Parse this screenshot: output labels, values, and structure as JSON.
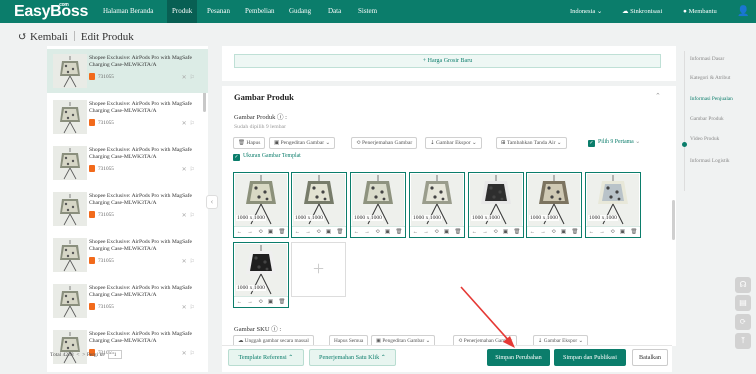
{
  "topbar": {
    "logo": "EasyBoss",
    "logo_sup": ".com",
    "nav": [
      "Halaman Beranda",
      "Produk",
      "Pesanan",
      "Pembelian",
      "Gudang",
      "Data",
      "Sistem"
    ],
    "active_nav": "Produk",
    "language": "Indonesia",
    "sync": "Sinkronisasi",
    "help": "Membantu",
    "colors": {
      "primary": "#0b7d6b",
      "accent_orange": "#f26a1b",
      "arrow_red": "#e53935"
    }
  },
  "breadcrumb": {
    "back": "Kembali",
    "title": "Edit Produk"
  },
  "product_list": {
    "items": [
      {
        "title": "Shopee Exclusive: AirPods Pro with MagSafe Charging Case-MLWK3TA/A",
        "id": "731055",
        "selected": true
      },
      {
        "title": "Shopee Exclusive: AirPods Pro with MagSafe Charging Case-MLWK3TA/A",
        "id": "731055",
        "selected": false
      },
      {
        "title": "Shopee Exclusive: AirPods Pro with MagSafe Charging Case-MLWK3TA/A",
        "id": "731055",
        "selected": false
      },
      {
        "title": "Shopee Exclusive: AirPods Pro with MagSafe Charging Case-MLWK3TA/A",
        "id": "731055",
        "selected": false
      },
      {
        "title": "Shopee Exclusive: AirPods Pro with MagSafe Charging Case-MLWK3TA/A",
        "id": "731055",
        "selected": false
      },
      {
        "title": "Shopee Exclusive: AirPods Pro with MagSafe Charging Case-MLWK3TA/A",
        "id": "731055",
        "selected": false
      },
      {
        "title": "Shopee Exclusive: AirPods Pro with MagSafe Charging Case-MLWK3TA/A",
        "id": "731055",
        "selected": false
      }
    ],
    "pager": {
      "total": "Total 4238",
      "prev": "<",
      "next": ">",
      "goto": "Pergi ke",
      "page": "1"
    }
  },
  "group_price_button": "+ Harga Grosir Baru",
  "product_images": {
    "heading": "Gambar Produk",
    "label": "Gambar Produk",
    "selected_hint": "Sudah dipilih 9 lembar",
    "toolbar": [
      "Hapus",
      "Pengeditan Gambar",
      "Penerjemahan Gambar",
      "Gambar Ekspor",
      "Tambahkan Tanda Air"
    ],
    "pick9": "Pilih 9 Pertama",
    "size_template": "Ukuran Gambar Templat",
    "images": [
      {
        "size": "1000 x 1000"
      },
      {
        "size": "1000 x 1000"
      },
      {
        "size": "1000 x 1000"
      },
      {
        "size": "1000 x 1000"
      },
      {
        "size": "1000 x 1000"
      },
      {
        "size": "1000 x 1000"
      },
      {
        "size": "1000 x 1000"
      },
      {
        "size": "1000 x 1000"
      }
    ],
    "tool_glyphs": [
      "←",
      "→",
      "⟲",
      "▣",
      "🗑"
    ]
  },
  "sku_images": {
    "label": "Gambar SKU",
    "toolbar": [
      "Unggah gambar secara massal",
      "Hapus Semua",
      "Pengeditan Gambar",
      "Penerjemahan Gambar",
      "Gambar Ekspor"
    ]
  },
  "bottom_bar": {
    "template": "Template Referensi",
    "translate": "Penerjemahan Satu Klik",
    "save": "Simpan Perubahan",
    "save_publish": "Simpan dan Publikasi",
    "cancel": "Batalkan"
  },
  "right_nav": {
    "items": [
      "Informasi Dasar",
      "Kategori & Atribut",
      "Informasi Penjualan",
      "Gambar Produk",
      "Video Produk",
      "Informasi Logistik"
    ],
    "active": "Informasi Penjualan"
  }
}
